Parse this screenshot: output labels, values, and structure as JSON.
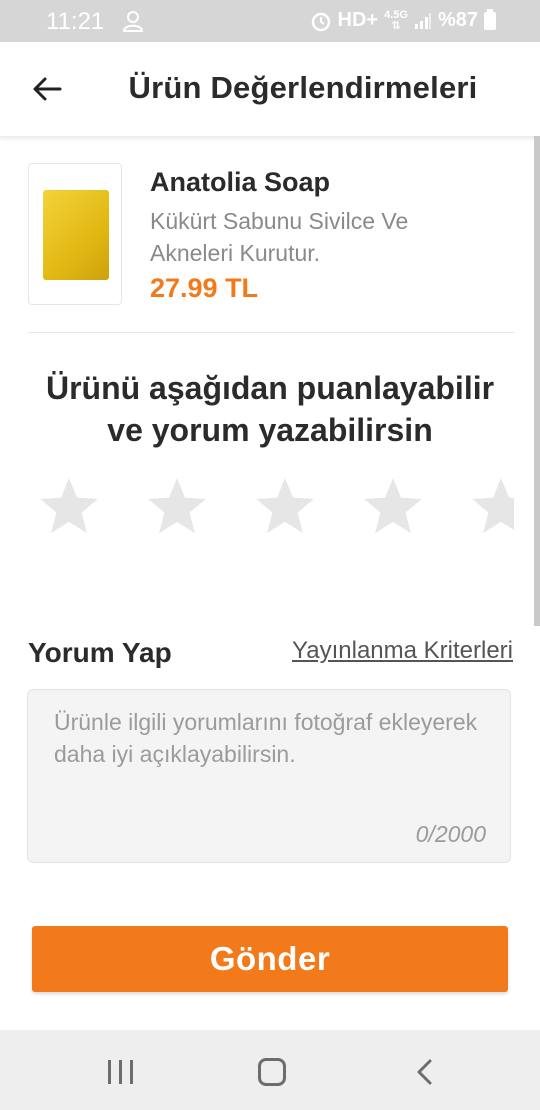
{
  "status_bar": {
    "time": "11:21",
    "network": "HD+",
    "network_type": "4.5G",
    "battery": "%87"
  },
  "header": {
    "title": "Ürün Değerlendirmeleri",
    "back_icon": "arrow-left-icon"
  },
  "product": {
    "name": "Anatolia Soap",
    "description": "Kükürt Sabunu Sivilce Ve Akneleri Kurutur.",
    "price": "27.99 TL"
  },
  "rating": {
    "prompt_line1": "Ürünü aşağıdan puanlayabilir",
    "prompt_line2": "ve yorum yazabilirsin",
    "stars_total": 5,
    "stars_selected": 0,
    "star_icon": "star-icon"
  },
  "comment": {
    "label": "Yorum Yap",
    "criteria_link": "Yayınlanma Kriterleri",
    "placeholder": "Ürünle ilgili yorumlarını fotoğraf ekleyerek daha iyi açıklayabilirsin.",
    "counter": "0/2000"
  },
  "submit_button": "Gönder",
  "colors": {
    "accent": "#f27a1a",
    "star_inactive": "#e6e6e6",
    "text_dark": "#2b2b2b",
    "text_muted": "#9b9b9b"
  }
}
